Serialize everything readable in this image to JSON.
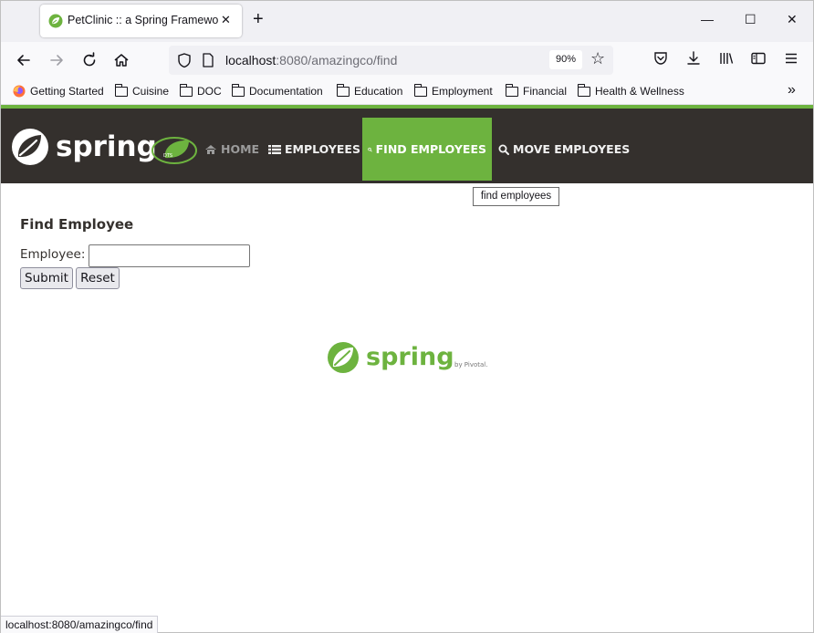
{
  "browser": {
    "tab": {
      "title": "PetClinic :: a Spring Framework demonstration",
      "close": "✕"
    },
    "new_tab": "+",
    "window_controls": {
      "minimize": "—",
      "maximize": "☐",
      "close": "✕"
    },
    "url": {
      "host": "localhost",
      "rest": ":8080/amazingco/find"
    },
    "zoom": "90%",
    "bookmarks": [
      {
        "label": "Getting Started",
        "icon": "firefox-icon"
      },
      {
        "label": "Cuisine",
        "icon": "folder-icon"
      },
      {
        "label": "DOC",
        "icon": "folder-icon"
      },
      {
        "label": "Documentation",
        "icon": "folder-icon"
      },
      {
        "label": "Education",
        "icon": "folder-icon"
      },
      {
        "label": "Employment",
        "icon": "folder-icon"
      },
      {
        "label": "Financial",
        "icon": "folder-icon"
      },
      {
        "label": "Health & Wellness",
        "icon": "folder-icon"
      }
    ],
    "bookmarks_overflow": "»",
    "status_url": "localhost:8080/amazingco/find"
  },
  "app": {
    "logo_text": "spring",
    "nav": [
      {
        "label": "HOME",
        "icon": "home-icon"
      },
      {
        "label": "EMPLOYEES",
        "icon": "list-icon"
      },
      {
        "label": "FIND EMPLOYEES",
        "icon": "search-icon",
        "active": true
      },
      {
        "label": "MOVE EMPLOYEES",
        "icon": "search-icon"
      }
    ],
    "tooltip": "find employees",
    "form": {
      "title": "Find Employee",
      "employee_label": "Employee:",
      "employee_value": "",
      "submit_label": "Submit",
      "reset_label": "Reset"
    },
    "footer_logo": {
      "text": "spring",
      "byline": "by Pivotal."
    }
  },
  "colors": {
    "spring_green": "#6db33f",
    "header_bg": "#34302d"
  }
}
